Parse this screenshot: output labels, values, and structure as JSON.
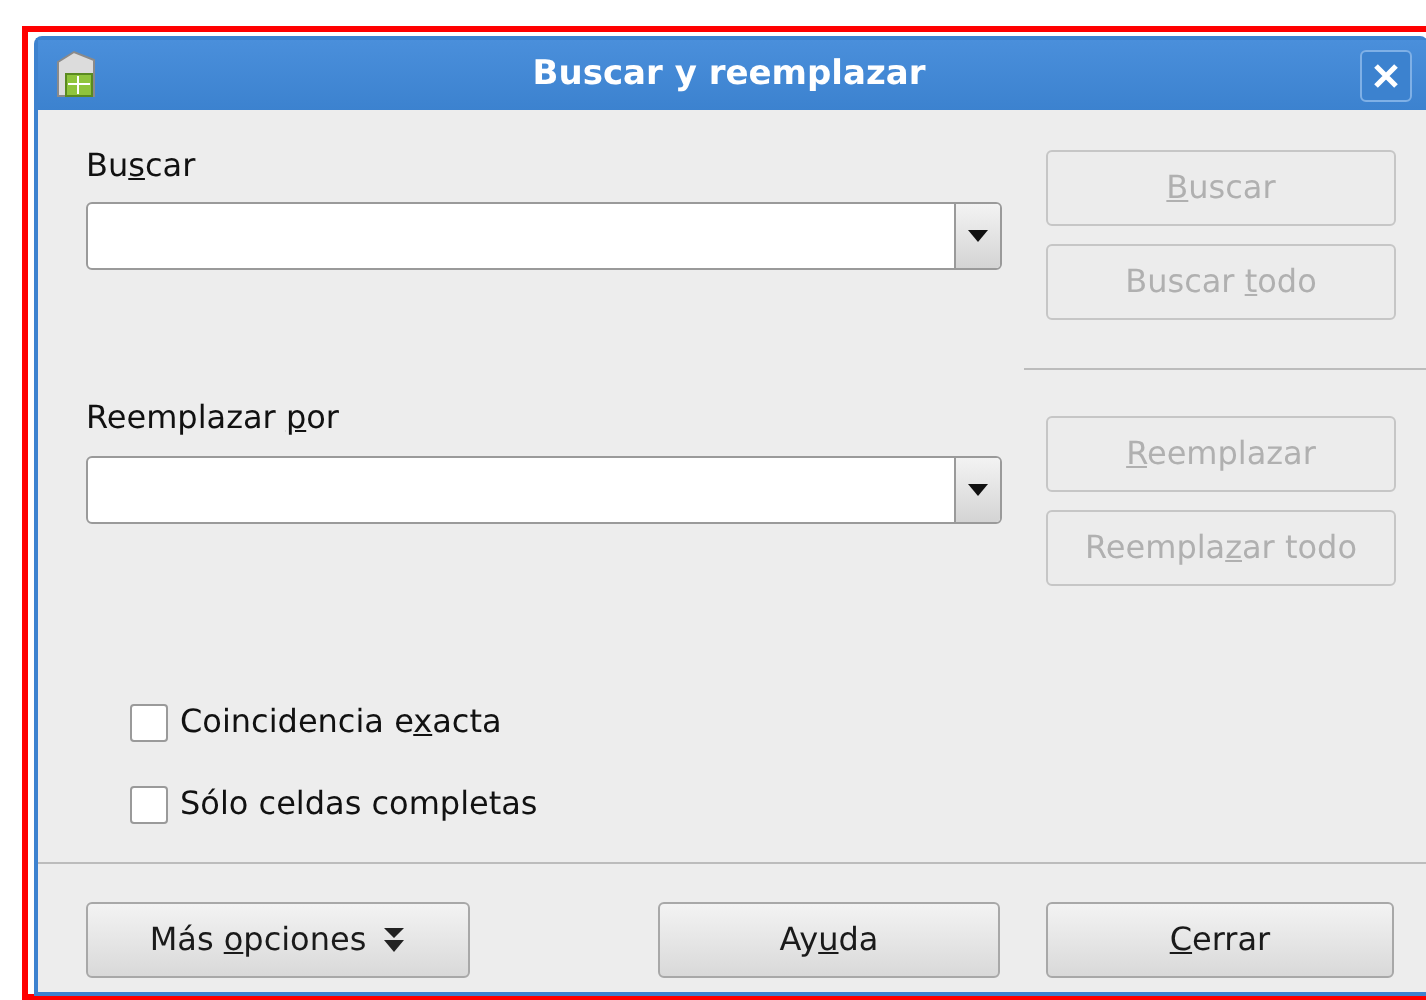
{
  "window": {
    "title": "Buscar y reemplazar"
  },
  "search": {
    "label": {
      "before": "Bu",
      "key": "s",
      "after": "car"
    }
  },
  "replace": {
    "label": {
      "before": "Reemplazar ",
      "key": "p",
      "after": "or"
    }
  },
  "search_buttons": [
    {
      "label": {
        "key": "B",
        "after": "uscar"
      },
      "disabled": true
    },
    {
      "label": {
        "before": "Buscar ",
        "key": "t",
        "after": "odo"
      },
      "disabled": true
    }
  ],
  "replace_buttons": [
    {
      "label": {
        "key": "R",
        "after": "eemplazar"
      },
      "disabled": true
    },
    {
      "label": {
        "before": "Reempla",
        "key": "z",
        "after": "ar todo"
      },
      "disabled": true
    }
  ],
  "options": [
    {
      "label": {
        "before": "Coincidencia e",
        "key": "x",
        "after": "acta"
      },
      "checked": false
    },
    {
      "label": {
        "before": "Sólo celdas completas"
      },
      "checked": false
    }
  ],
  "footer_buttons": [
    {
      "kind": "more",
      "label": {
        "before": "Más ",
        "key": "o",
        "after": "pciones"
      }
    },
    {
      "kind": "help",
      "label": {
        "before": "Ay",
        "key": "u",
        "after": "da"
      }
    },
    {
      "kind": "close",
      "label": {
        "key": "C",
        "after": "errar"
      }
    }
  ]
}
